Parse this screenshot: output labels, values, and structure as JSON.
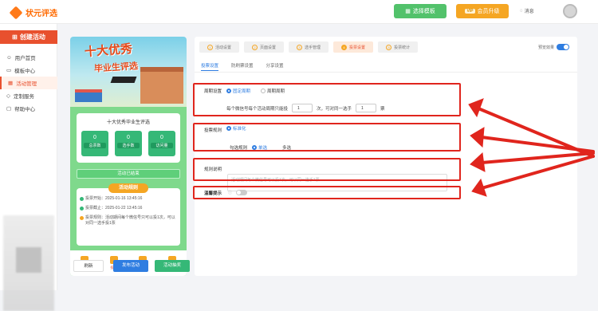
{
  "app": {
    "logo_text": "状元评选"
  },
  "header": {
    "template_btn": "选择模板",
    "upgrade_btn": "会员升级",
    "vip_badge": "VIP",
    "message_label": "消息"
  },
  "sidebar": {
    "create_btn": "创建活动",
    "items": [
      {
        "label": "用户首页"
      },
      {
        "label": "模板中心"
      },
      {
        "label": "活动管理"
      },
      {
        "label": "定制服务"
      },
      {
        "label": "帮助中心"
      }
    ]
  },
  "preview": {
    "banner_line1": "十大优秀",
    "banner_line2": "毕业生评选",
    "card_title": "十大优秀毕业生评选",
    "stats": [
      {
        "num": "0",
        "label": "总票数"
      },
      {
        "num": "0",
        "label": "选手数"
      },
      {
        "num": "0",
        "label": "访问量"
      }
    ],
    "ended": "活动已结束",
    "rules_title": "活动规则",
    "rules": [
      "投票开始：2025-01-16 13:45:16",
      "投票截止：2025-01-22 13:45:16",
      "投票规则：活动期间每个微信号只可以投1次，可以对同一选手投1票"
    ],
    "tabs": [
      {
        "label": "介绍"
      },
      {
        "label": "投票"
      },
      {
        "label": "排行"
      },
      {
        "label": "报名"
      }
    ],
    "btn_refresh": "刷新",
    "btn_publish": "发布活动",
    "btn_lottery": "活动抽奖"
  },
  "settings": {
    "steps": [
      {
        "label": "活动设置"
      },
      {
        "label": "页面设置"
      },
      {
        "label": "选手管理"
      },
      {
        "label": "投票设置"
      },
      {
        "label": "投票统计"
      }
    ],
    "preview_label": "预览效果",
    "subtabs": [
      {
        "label": "投票设置"
      },
      {
        "label": "防刷票设置"
      },
      {
        "label": "分享设置"
      }
    ],
    "period_label": "周期设置",
    "period_opt1": "固定周期",
    "period_opt2": "周期周期",
    "period_text1": "每个微信号每个活动周期只能投",
    "period_value1": "1",
    "period_text2": "次，可对同一选手",
    "period_value2": "1",
    "period_text3": "票",
    "vote_rule_label": "投票规则",
    "vote_rule_opt": "标准化",
    "select_rule_label": "勾选规则",
    "select_opt1": "单选",
    "select_opt2": "多选",
    "desc_label": "规则说明",
    "desc_placeholder": "活动期间每个微信号可以投1次，可以同一选手1票",
    "reminder_label": "温馨提示"
  }
}
